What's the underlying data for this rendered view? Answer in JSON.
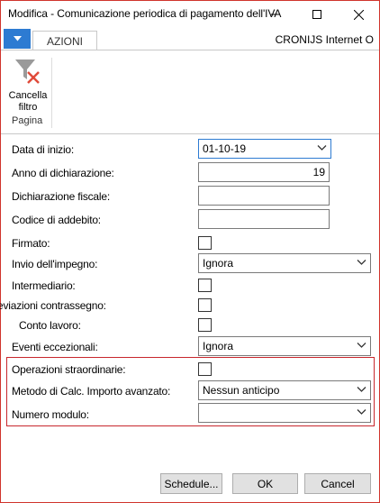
{
  "window": {
    "title": "Modifica - Comunicazione periodica di pagamento dell'IVA",
    "company": "CRONIJS Internet O"
  },
  "ribbon": {
    "tab_label": "AZIONI",
    "button_label_line1": "Cancella",
    "button_label_line2": "filtro",
    "group_label": "Pagina"
  },
  "form": {
    "data_inizio": {
      "label": "Data di inizio:",
      "value": "01-10-19"
    },
    "anno_dichiarazione": {
      "label": "Anno di dichiarazione:",
      "value": "19"
    },
    "dichiarazione_fiscale": {
      "label": "Dichiarazione fiscale:",
      "value": ""
    },
    "codice_addebito": {
      "label": "Codice di addebito:",
      "value": ""
    },
    "firmato": {
      "label": "Firmato:",
      "checked": false
    },
    "invio_impegno": {
      "label": "Invio dell'impegno:",
      "value": "Ignora"
    },
    "intermediario": {
      "label": "Intermediario:",
      "checked": false
    },
    "deviazioni": {
      "label": "eviazioni contrassegno:",
      "checked": false
    },
    "conto_lavoro": {
      "label": "Conto lavoro:",
      "checked": false
    },
    "eventi_eccezionali": {
      "label": "Eventi eccezionali:",
      "value": "Ignora"
    },
    "operazioni_straordinarie": {
      "label": "Operazioni straordinarie:",
      "checked": false
    },
    "metodo_calc": {
      "label": "Metodo di Calc. Importo avanzato:",
      "value": "Nessun anticipo"
    },
    "numero_modulo": {
      "label": "Numero modulo:",
      "value": ""
    }
  },
  "buttons": {
    "schedule": "Schedule...",
    "ok": "OK",
    "cancel": "Cancel"
  },
  "colors": {
    "accent": "#2d7bd2",
    "highlight_border": "#c8272d"
  }
}
